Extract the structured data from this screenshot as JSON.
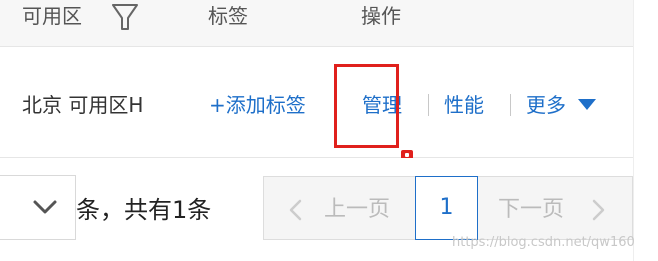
{
  "table": {
    "headers": {
      "zone": "可用区",
      "tags": "标签",
      "actions": "操作"
    },
    "row": {
      "zone": "北京 可用区H",
      "add_tag": "+添加标签",
      "manage": "管理",
      "performance": "性能",
      "more": "更多"
    }
  },
  "pagination": {
    "total_text": "条，共有1条",
    "prev": "上一页",
    "current_page": "1",
    "next": "下一页"
  },
  "watermark": "https://blog.csdn.net/qw160",
  "icons": {
    "filter": "filter-icon",
    "more_caret": "caret-down-icon",
    "page_size_dropdown": "chevron-down-icon",
    "prev_arrow": "chevron-left-icon",
    "next_arrow": "chevron-right-icon"
  },
  "colors": {
    "link": "#1e6fc9",
    "annotation": "#e0201c",
    "header_bg": "#f7f7f7",
    "disabled_text": "#bbbbbb"
  }
}
